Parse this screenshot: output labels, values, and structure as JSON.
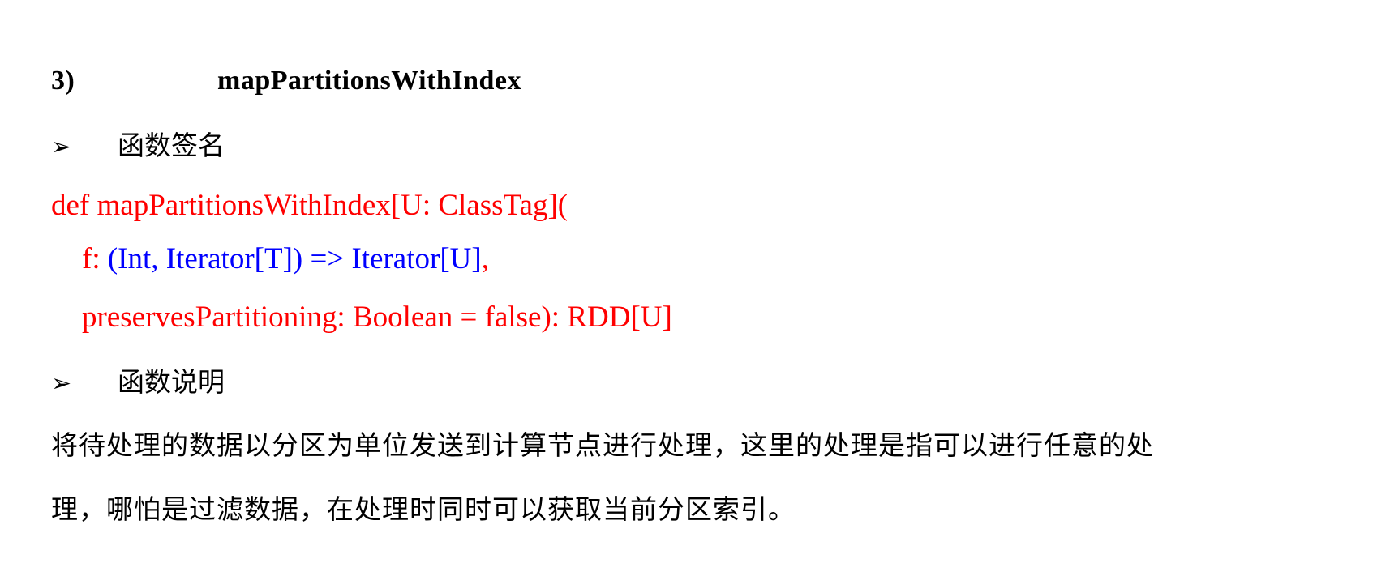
{
  "section": {
    "number": "3)",
    "title": "mapPartitionsWithIndex"
  },
  "bullets": {
    "arrow": "➢",
    "signature_label": "函数签名",
    "description_label": "函数说明"
  },
  "code": {
    "line1": "def mapPartitionsWithIndex[U: ClassTag](",
    "line2_prefix": "f: ",
    "line2_type": "(Int, Iterator[T]) => Iterator[U]",
    "line2_suffix": ",",
    "line3": "preservesPartitioning: Boolean = false): RDD[U]"
  },
  "description": {
    "line1": "将待处理的数据以分区为单位发送到计算节点进行处理，这里的处理是指可以进行任意的处",
    "line2": "理，哪怕是过滤数据，在处理时同时可以获取当前分区索引。"
  },
  "colors": {
    "code_keyword": "#ff0000",
    "code_type": "#0000ff",
    "text": "#000000"
  }
}
